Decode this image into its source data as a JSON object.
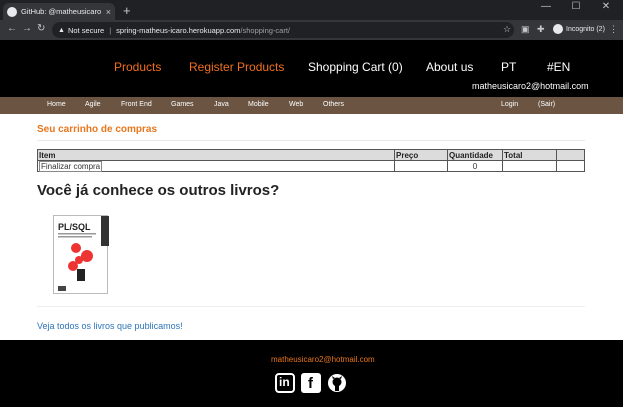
{
  "browser": {
    "tab_title": "GitHub: @matheusicaro - Casa d",
    "tab_close": "×",
    "new_tab": "+",
    "win_min": "—",
    "win_max": "☐",
    "win_close": "✕",
    "security_label": "Not secure",
    "url_host": "spring-matheus-icaro.herokuapp.com",
    "url_path": "/shopping-cart/",
    "incognito_label": "Incognito (2)"
  },
  "topnav": {
    "products": "Products",
    "register_products": "Register Products",
    "shopping_cart": "Shopping Cart (0)",
    "about_us": "About us",
    "pt": "PT",
    "en": "#EN",
    "user_email": "matheusicaro2@hotmail.com"
  },
  "categories": [
    "Home",
    "Agile",
    "Front End",
    "Games",
    "Java",
    "Mobile",
    "Web",
    "Others"
  ],
  "account": {
    "login": "Login",
    "logout": "(Sair)"
  },
  "cart": {
    "title": "Seu carrinho de compras",
    "headers": {
      "item": "Item",
      "price": "Preço",
      "quantity": "Quantidade",
      "total": "Total"
    },
    "checkout_button": "Finalizar compra",
    "quantity_value": "0"
  },
  "recommend": {
    "heading": "Você já conhece os outros livros?",
    "book_title": "PL/SQL",
    "all_books_link": "Veja todos os livros que publicamos!"
  },
  "footer": {
    "email": "matheusicaro2@hotmail.com",
    "linkedin_glyph": "in",
    "facebook_glyph": "f"
  },
  "colors": {
    "accent_orange": "#e8761c",
    "category_bar": "#6b5542",
    "link_blue": "#2b74b8"
  }
}
